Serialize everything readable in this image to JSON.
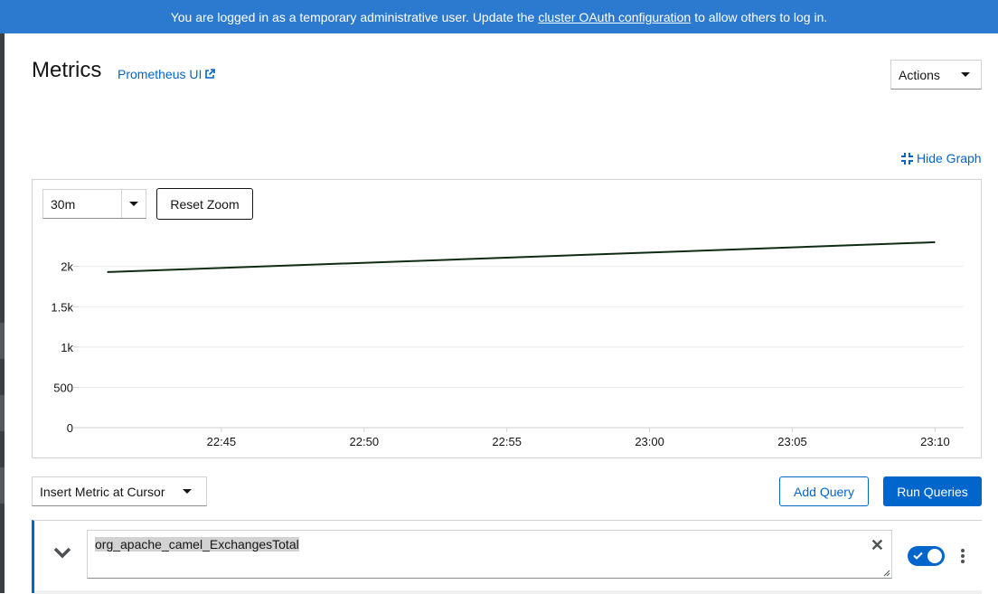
{
  "banner": {
    "prefix": "You are logged in as a temporary administrative user. Update the",
    "link": "cluster OAuth configuration",
    "suffix": "to allow others to log in."
  },
  "header": {
    "title": "Metrics",
    "prometheus_link": "Prometheus UI",
    "actions_label": "Actions"
  },
  "graph_controls": {
    "hide_graph": "Hide Graph",
    "time_range": "30m",
    "reset_zoom": "Reset Zoom"
  },
  "chart_data": {
    "type": "line",
    "xlabel": "",
    "ylabel": "",
    "x_ticks": [
      "22:45",
      "22:50",
      "22:55",
      "23:00",
      "23:05",
      "23:10"
    ],
    "y_ticks": [
      "0",
      "500",
      "1k",
      "1.5k",
      "2k"
    ],
    "ylim": [
      0,
      2400
    ],
    "grid": true,
    "series": [
      {
        "color": "#0f2c13",
        "points": [
          {
            "x": "22:41",
            "y": 1930
          },
          {
            "x": "23:10",
            "y": 2300
          }
        ]
      }
    ]
  },
  "query_toolbar": {
    "insert_metric": "Insert Metric at Cursor",
    "add_query": "Add Query",
    "run_queries": "Run Queries"
  },
  "query": {
    "expression": "org_apache_camel_ExchangesTotal",
    "enabled": true
  },
  "colors": {
    "banner": "#2b7ad0",
    "primary": "#0066cc",
    "series_line": "#0f2c13"
  }
}
